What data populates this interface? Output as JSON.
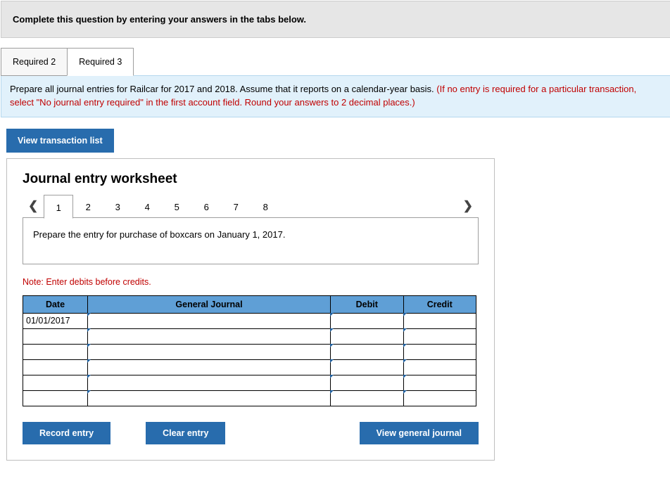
{
  "banner": {
    "text": "Complete this question by entering your answers in the tabs below."
  },
  "tabs": {
    "items": [
      {
        "label": "Required 2"
      },
      {
        "label": "Required 3"
      }
    ],
    "activeIndex": 1
  },
  "context": {
    "main": "Prepare all journal entries for Railcar for 2017 and 2018. Assume that it reports on a calendar-year basis. ",
    "hint": "(If no entry is required for a particular transaction, select \"No journal entry required\" in the first account field. Round your answers to 2 decimal places.)"
  },
  "buttons": {
    "viewList": "View transaction list",
    "record": "Record entry",
    "clear": "Clear entry",
    "viewJournal": "View general journal"
  },
  "worksheet": {
    "title": "Journal entry worksheet",
    "pages": [
      "1",
      "2",
      "3",
      "4",
      "5",
      "6",
      "7",
      "8"
    ],
    "activePage": 0,
    "prompt": "Prepare the entry for purchase of boxcars on January 1, 2017.",
    "note": "Note: Enter debits before credits.",
    "columns": {
      "date": "Date",
      "gj": "General Journal",
      "debit": "Debit",
      "credit": "Credit"
    },
    "rows": [
      {
        "date": "01/01/2017",
        "gj": "",
        "debit": "",
        "credit": ""
      },
      {
        "date": "",
        "gj": "",
        "debit": "",
        "credit": ""
      },
      {
        "date": "",
        "gj": "",
        "debit": "",
        "credit": ""
      },
      {
        "date": "",
        "gj": "",
        "debit": "",
        "credit": ""
      },
      {
        "date": "",
        "gj": "",
        "debit": "",
        "credit": ""
      },
      {
        "date": "",
        "gj": "",
        "debit": "",
        "credit": ""
      }
    ]
  }
}
